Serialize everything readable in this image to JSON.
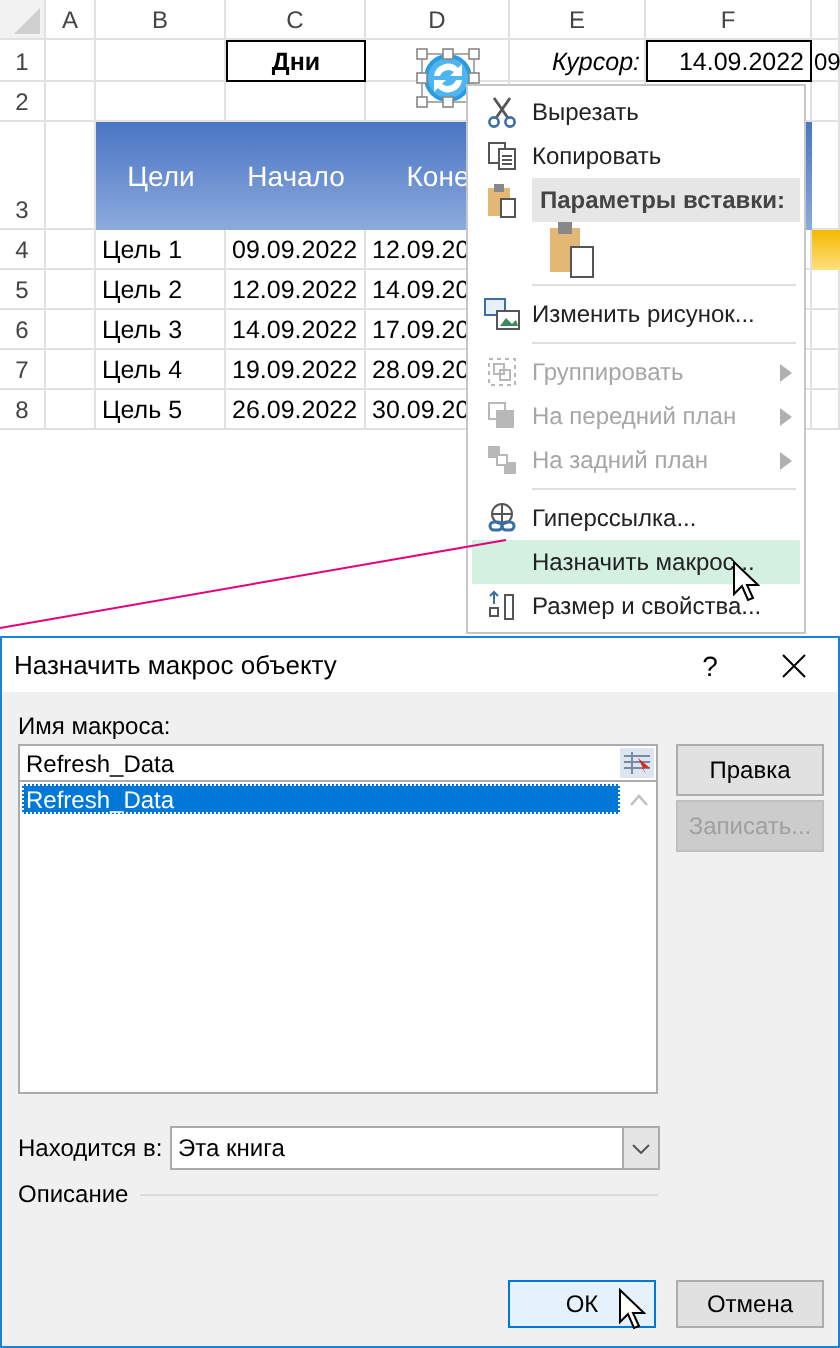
{
  "sheet": {
    "column_headers": [
      "A",
      "B",
      "C",
      "D",
      "E",
      "F"
    ],
    "row_numbers": [
      "1",
      "2",
      "3",
      "4",
      "5",
      "6",
      "7",
      "8"
    ],
    "top_row": {
      "days_label": "Дни",
      "cursor_label": "Курсор:",
      "cursor_value": "14.09.2022",
      "next_value": "09"
    },
    "table": {
      "headers": [
        "Цели",
        "Начало",
        "Коне"
      ],
      "rows": [
        [
          "Цель 1",
          "09.09.2022",
          "12.09.20"
        ],
        [
          "Цель 2",
          "12.09.2022",
          "14.09.20"
        ],
        [
          "Цель 3",
          "14.09.2022",
          "17.09.20"
        ],
        [
          "Цель 4",
          "19.09.2022",
          "28.09.20"
        ],
        [
          "Цель 5",
          "26.09.2022",
          "30.09.20"
        ]
      ]
    }
  },
  "context_menu": {
    "items": [
      {
        "kind": "action",
        "label": "Вырезать",
        "disabled": false,
        "submenu": false,
        "selected": false
      },
      {
        "kind": "action",
        "label": "Копировать",
        "disabled": false,
        "submenu": false,
        "selected": false
      },
      {
        "kind": "header",
        "label": "Параметры вставки:"
      },
      {
        "kind": "paste"
      },
      {
        "kind": "separator"
      },
      {
        "kind": "action",
        "label": "Изменить рисунок...",
        "disabled": false,
        "submenu": false,
        "selected": false
      },
      {
        "kind": "separator"
      },
      {
        "kind": "action",
        "label": "Группировать",
        "disabled": true,
        "submenu": true,
        "selected": false
      },
      {
        "kind": "action",
        "label": "На передний план",
        "disabled": true,
        "submenu": true,
        "selected": false
      },
      {
        "kind": "action",
        "label": "На задний план",
        "disabled": true,
        "submenu": true,
        "selected": false
      },
      {
        "kind": "separator"
      },
      {
        "kind": "action",
        "label": "Гиперссылка...",
        "disabled": false,
        "submenu": false,
        "selected": false
      },
      {
        "kind": "action",
        "label": "Назначить макрос...",
        "disabled": false,
        "submenu": false,
        "selected": true
      },
      {
        "kind": "action",
        "label": "Размер и свойства...",
        "disabled": false,
        "submenu": false,
        "selected": false
      }
    ]
  },
  "dialog": {
    "title": "Назначить макрос объекту",
    "help": "?",
    "macro_name_label": "Имя макроса:",
    "macro_name_value": "Refresh_Data",
    "macros": [
      {
        "name": "Refresh_Data",
        "selected": true
      }
    ],
    "side_buttons": [
      {
        "label": "Правка",
        "disabled": false
      },
      {
        "label": "Записать...",
        "disabled": true
      }
    ],
    "location_label": "Находится в:",
    "location_value": "Эта книга",
    "description_label": "Описание",
    "buttons": [
      {
        "label": "ОК",
        "focused": true
      },
      {
        "label": "Отмена",
        "focused": false
      }
    ]
  }
}
